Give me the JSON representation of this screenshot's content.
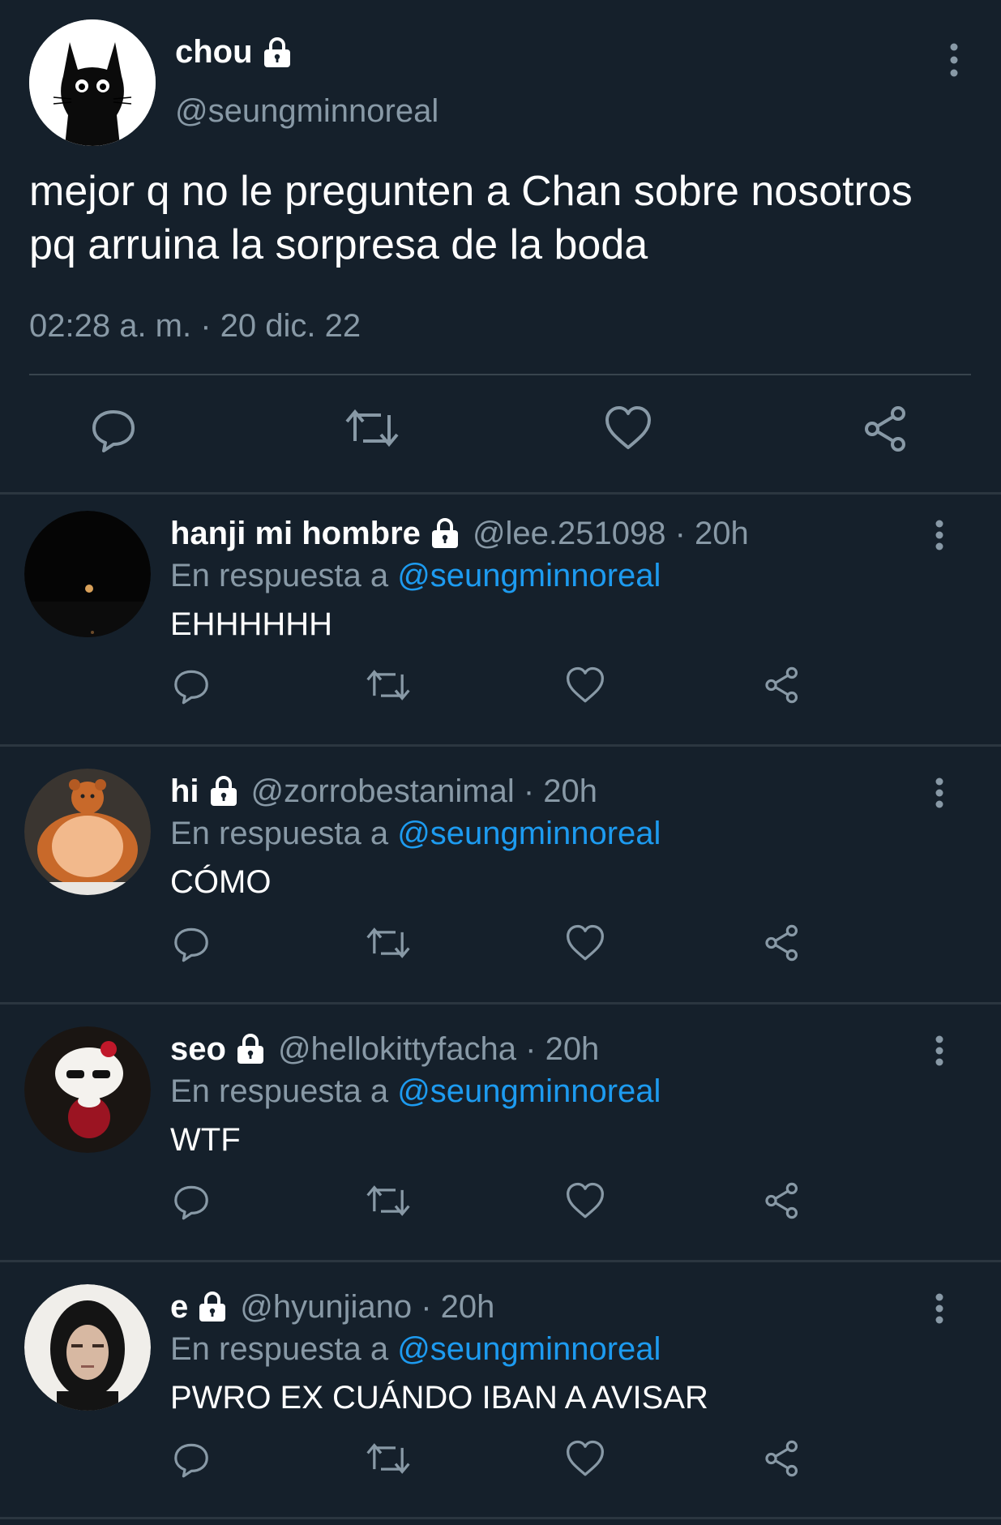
{
  "main_tweet": {
    "display_name": "chou",
    "handle": "@seungminnoreal",
    "text": "mejor q no le pregunten a Chan sobre nosotros pq arruina la sorpresa de la boda",
    "timestamp": "02:28 a. m. · 20 dic. 22",
    "avatar_icon": "black-cat-avatar",
    "protected": true
  },
  "replies": [
    {
      "display_name": "hanji mi hombre",
      "handle": "@lee.251098 · 20h",
      "reply_prefix": "En respuesta a",
      "reply_to": "@seungminnoreal",
      "text": "EHHHHHH",
      "avatar_icon": "night-moon-avatar",
      "protected": true
    },
    {
      "display_name": "hi",
      "handle": "@zorrobestanimal · 20h",
      "reply_prefix": "En respuesta a",
      "reply_to": "@seungminnoreal",
      "text": "CÓMO",
      "avatar_icon": "plush-bear-avatar",
      "protected": true
    },
    {
      "display_name": "seo",
      "handle": "@hellokittyfacha · 20h",
      "reply_prefix": "En respuesta a",
      "reply_to": "@seungminnoreal",
      "text": "WTF",
      "avatar_icon": "hello-kitty-avatar",
      "protected": true
    },
    {
      "display_name": "e",
      "handle": "@hyunjiano · 20h",
      "reply_prefix": "En respuesta a",
      "reply_to": "@seungminnoreal",
      "text": "PWRO EX CUÁNDO IBAN A AVISAR",
      "avatar_icon": "portrait-avatar",
      "protected": true
    }
  ],
  "colors": {
    "background": "#15202b",
    "secondary_text": "#8899a6",
    "mention": "#1d9bf0",
    "divider": "#2b3640"
  }
}
